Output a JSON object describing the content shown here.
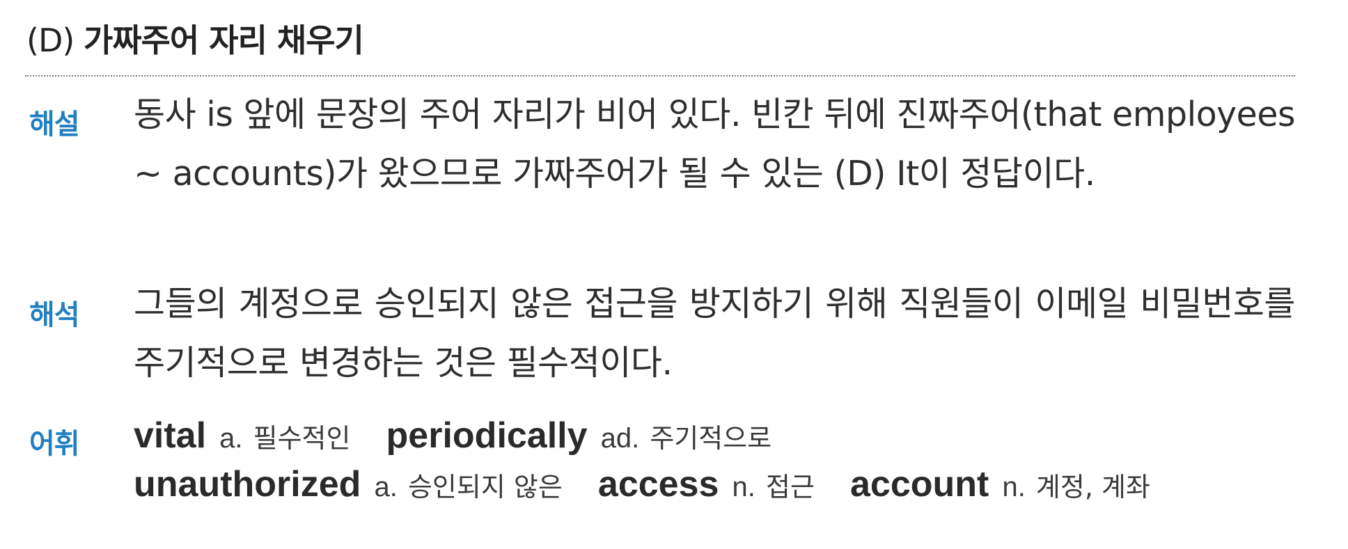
{
  "heading": {
    "choice": "(D)",
    "text": "가짜주어 자리 채우기"
  },
  "sections": {
    "explanation": {
      "label": "해설",
      "text": "동사 is 앞에 문장의 주어 자리가 비어 있다. 빈칸 뒤에 진짜주어(that employees ~ accounts)가 왔으므로 가짜주어가 될 수 있는 (D) It이 정답이다."
    },
    "translation": {
      "label": "해석",
      "text": "그들의 계정으로 승인되지 않은 접근을 방지하기 위해 직원들이 이메일 비밀번호를 주기적으로 변경하는 것은 필수적이다."
    },
    "vocabulary": {
      "label": "어휘",
      "line1": [
        {
          "word": "vital",
          "pos": "a.",
          "meaning": "필수적인"
        },
        {
          "word": "periodically",
          "pos": "ad.",
          "meaning": "주기적으로"
        }
      ],
      "line2": [
        {
          "word": "unauthorized",
          "pos": "a.",
          "meaning": "승인되지 않은"
        },
        {
          "word": "access",
          "pos": "n.",
          "meaning": "접근"
        },
        {
          "word": "account",
          "pos": "n.",
          "meaning": "계정, 계좌"
        }
      ]
    }
  },
  "colors": {
    "label": "#1f7fc0",
    "text": "#2e2e2e",
    "divider": "#777777"
  }
}
